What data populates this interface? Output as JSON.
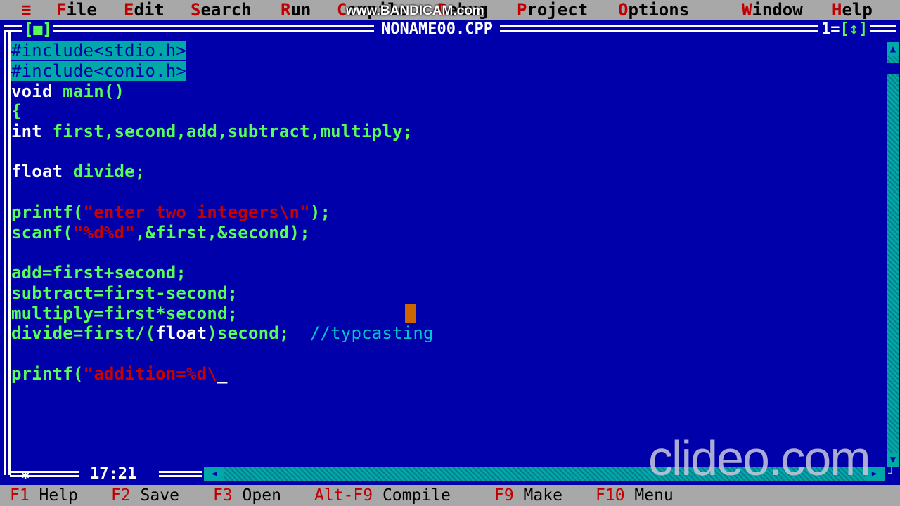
{
  "menubar": {
    "system_icon": "≡",
    "items": [
      {
        "hot": "F",
        "rest": "ile"
      },
      {
        "hot": "E",
        "rest": "dit"
      },
      {
        "hot": "S",
        "rest": "earch"
      },
      {
        "hot": "R",
        "rest": "un"
      },
      {
        "hot": "C",
        "rest": "ompile"
      },
      {
        "hot": "D",
        "rest": "ebug"
      },
      {
        "hot": "P",
        "rest": "roject"
      },
      {
        "hot": "O",
        "rest": "ptions"
      },
      {
        "hot": "W",
        "rest": "indow"
      },
      {
        "hot": "H",
        "rest": "elp"
      }
    ]
  },
  "overlay": {
    "top_watermark": "www.BANDICAM.com",
    "bottom_watermark": "clideo.com"
  },
  "window": {
    "close_box": "[■]",
    "title": "NONAME00.CPP",
    "number": "1=",
    "zoom_box": "[↕]",
    "cursor_position": "17:21"
  },
  "code": {
    "l1": "#include<stdio.h>",
    "l2": "#include<conio.h>",
    "l3_kw": "void",
    "l3_id": " main()",
    "l4": "{",
    "l5_kw": "int",
    "l5_id": " first,second,add,subtract,multiply;",
    "l7_kw": "float",
    "l7_id": " divide;",
    "l9_a": "printf(",
    "l9_s": "\"enter two integers\\n\"",
    "l9_b": ");",
    "l10_a": "scanf(",
    "l10_s": "\"%d%d\"",
    "l10_b": ",&first,&second);",
    "l12": "add=first+second;",
    "l13": "subtract=first-second;",
    "l14": "multiply=first*second;",
    "l15_a": "divide=first/(",
    "l15_kw": "float",
    "l15_b": ")second;  ",
    "l15_c": "//typcasting",
    "l17_a": "printf(",
    "l17_s": "\"addition=%d\\",
    "l17_cursor": "_"
  },
  "keybar": [
    {
      "key": "F1",
      "label": " Help"
    },
    {
      "key": "F2",
      "label": " Save"
    },
    {
      "key": "F3",
      "label": " Open"
    },
    {
      "key": "Alt-F9",
      "label": " Compile"
    },
    {
      "key": "F9",
      "label": " Make"
    },
    {
      "key": "F10",
      "label": " Menu"
    }
  ],
  "colors": {
    "editor_bg": "#0000aa",
    "menu_bg": "#a8a8a8",
    "hotkey": "#c00000",
    "identifier": "#55ff55",
    "string": "#c80000",
    "comment": "#00c8c8"
  }
}
